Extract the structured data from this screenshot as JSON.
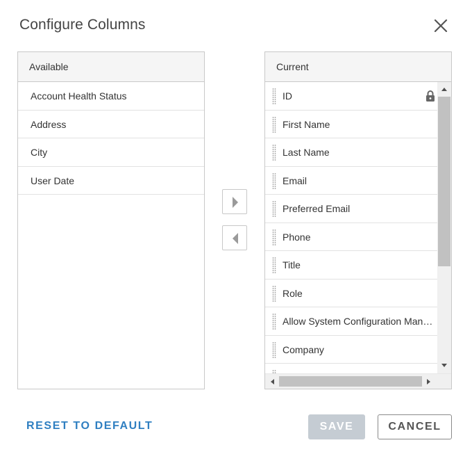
{
  "dialog": {
    "title": "Configure Columns"
  },
  "available": {
    "header": "Available",
    "items": [
      "Account Health Status",
      "Address",
      "City",
      "User Date"
    ]
  },
  "current": {
    "header": "Current",
    "items": [
      "ID",
      "First Name",
      "Last Name",
      "Email",
      "Preferred Email",
      "Phone",
      "Title",
      "Role",
      "Allow System Configuration Management",
      "Company"
    ]
  },
  "footer": {
    "reset_label": "RESET TO DEFAULT",
    "save_label": "SAVE",
    "cancel_label": "CANCEL"
  },
  "icons": {
    "close": "close-icon",
    "move_right": "caret-right-icon",
    "move_left": "caret-left-icon",
    "lock": "lock-icon",
    "drag": "drag-handle-icon"
  },
  "colors": {
    "link": "#2f7fc1",
    "save_disabled_bg": "#c5ccd3",
    "header_bg": "#f5f5f5",
    "border": "#c8c8c8"
  }
}
